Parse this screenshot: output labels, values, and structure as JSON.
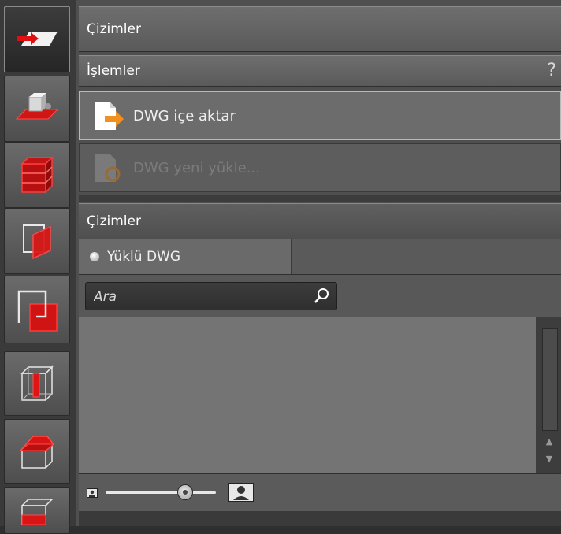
{
  "panel": {
    "title": "Çizimler"
  },
  "operations": {
    "title": "İşlemler",
    "help": "?",
    "import_label": "DWG içe aktar",
    "reload_label": "DWG yeni yükle..."
  },
  "drawings": {
    "title": "Çizimler",
    "tab_label": "Yüklü DWG",
    "search_placeholder": "Ara",
    "thumbnail_size_fraction": 0.72
  },
  "sidebar": {
    "tools": [
      {
        "icon": "drawing-import-icon",
        "active": true
      },
      {
        "icon": "object-on-plane-icon",
        "active": false
      },
      {
        "icon": "floors-stack-icon",
        "active": false
      },
      {
        "icon": "section-plane-icon",
        "active": false
      },
      {
        "icon": "overlap-rectangles-icon",
        "active": false
      },
      {
        "icon": "column-box-icon",
        "active": false
      },
      {
        "icon": "roof-box-icon",
        "active": false
      },
      {
        "icon": "foundation-box-icon",
        "active": false
      }
    ]
  },
  "colors": {
    "accent_red": "#e01010",
    "accent_orange": "#f0901e"
  }
}
